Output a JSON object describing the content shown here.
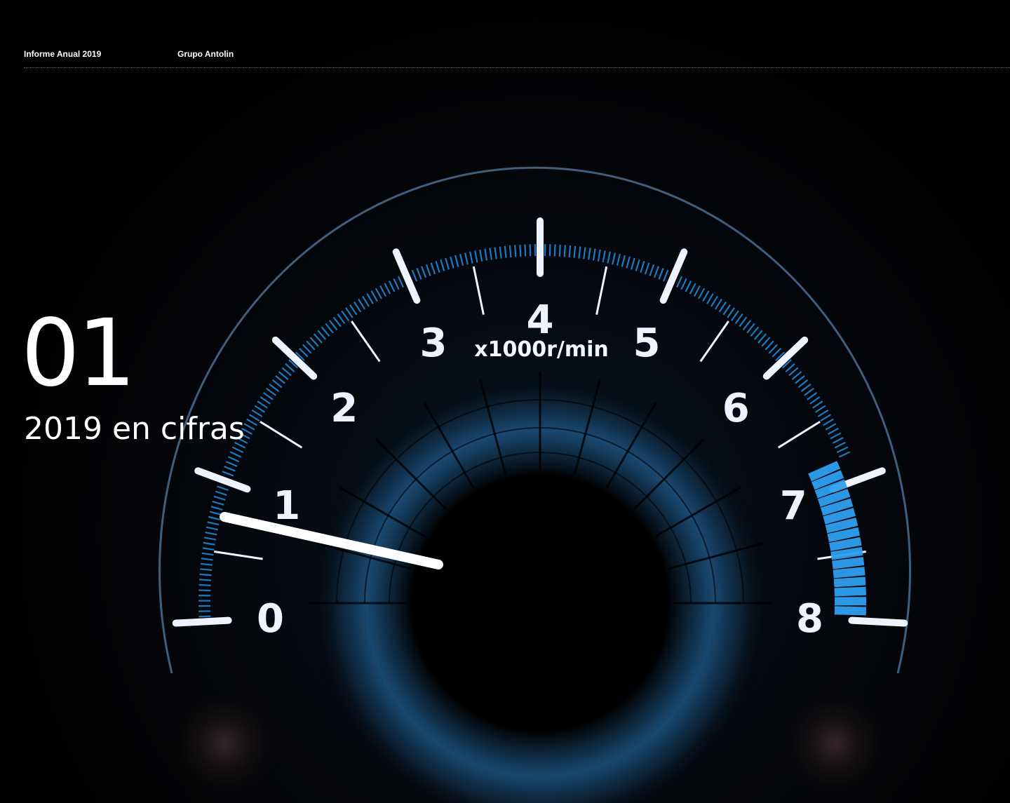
{
  "header": {
    "report_title": "Informe Anual 2019",
    "company": "Grupo Antolin"
  },
  "section": {
    "number": "01",
    "title": "2019 en cifras"
  },
  "gauge": {
    "unit_label": "x1000r/min",
    "scale_labels": [
      "0",
      "1",
      "2",
      "3",
      "4",
      "5",
      "6",
      "7",
      "8"
    ],
    "needle_value": 0.55,
    "redline_start": 7,
    "colors": {
      "accent": "#1e8fe0",
      "redline": "#2f9ff0",
      "marks": "#eef4ff",
      "rim": "#5f87a8",
      "background": "#000000"
    }
  },
  "image": {
    "subject": "tachometer-gauge"
  }
}
